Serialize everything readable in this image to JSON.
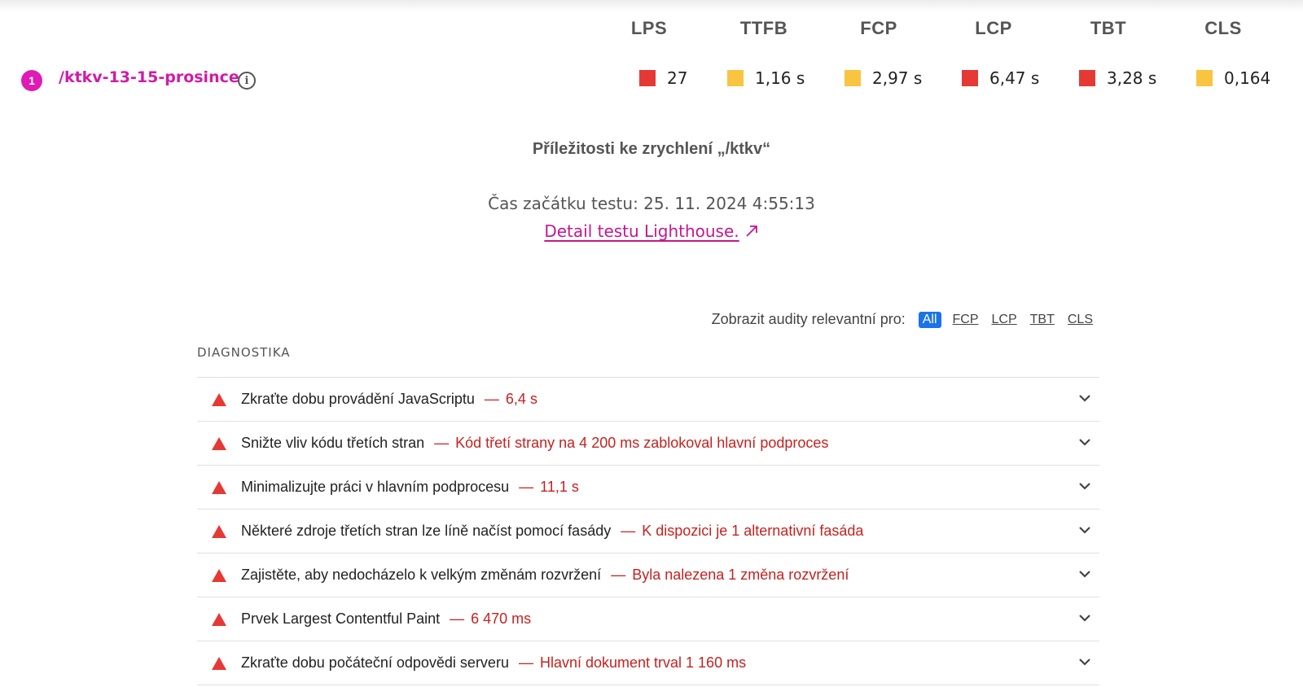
{
  "metrics": {
    "headers": [
      "LPS",
      "TTFB",
      "FCP",
      "LCP",
      "TBT",
      "CLS"
    ],
    "values": [
      {
        "value": "27",
        "status_color": "#e53935"
      },
      {
        "value": "1,16 s",
        "status_color": "#f9c440"
      },
      {
        "value": "2,97 s",
        "status_color": "#f9c440"
      },
      {
        "value": "6,47 s",
        "status_color": "#e53935"
      },
      {
        "value": "3,28 s",
        "status_color": "#e53935"
      },
      {
        "value": "0,164",
        "status_color": "#f9c440"
      }
    ]
  },
  "url_row": {
    "rank": "1",
    "url": "/ktkv-13-15-prosince",
    "info_icon": "info-icon"
  },
  "section": {
    "title": "Příležitosti ke zrychlení „/ktkv“",
    "test_time": "Čas začátku testu: 25. 11. 2024 4:55:13",
    "detail_link": "Detail testu Lighthouse."
  },
  "filter": {
    "label": "Zobrazit audity relevantní pro:",
    "options": [
      "All",
      "FCP",
      "LCP",
      "TBT",
      "CLS"
    ],
    "active": "All"
  },
  "diagnostics": {
    "label": "DIAGNOSTIKA",
    "separator": "—",
    "items": [
      {
        "title": "Zkraťte dobu provádění JavaScriptu",
        "display": "6,4 s"
      },
      {
        "title": "Snižte vliv kódu třetích stran",
        "display": "Kód třetí strany na 4 200 ms zablokoval hlavní podproces"
      },
      {
        "title": "Minimalizujte práci v hlavním podprocesu",
        "display": "11,1 s"
      },
      {
        "title": "Některé zdroje třetích stran lze líně načíst pomocí fasády",
        "display": "K dispozici je 1 alternativní fasáda"
      },
      {
        "title": "Zajistěte, aby nedocházelo k velkým změnám rozvržení",
        "display": "Byla nalezena 1 změna rozvržení"
      },
      {
        "title": "Prvek Largest Contentful Paint",
        "display": "6 470 ms"
      },
      {
        "title": "Zkraťte dobu počáteční odpovědi serveru",
        "display": "Hlavní dokument trval 1 160 ms"
      }
    ]
  },
  "colors": {
    "accent": "#d21aa8",
    "fail": "#e53935",
    "warn": "#f9c440",
    "active_filter": "#1a73e8"
  }
}
